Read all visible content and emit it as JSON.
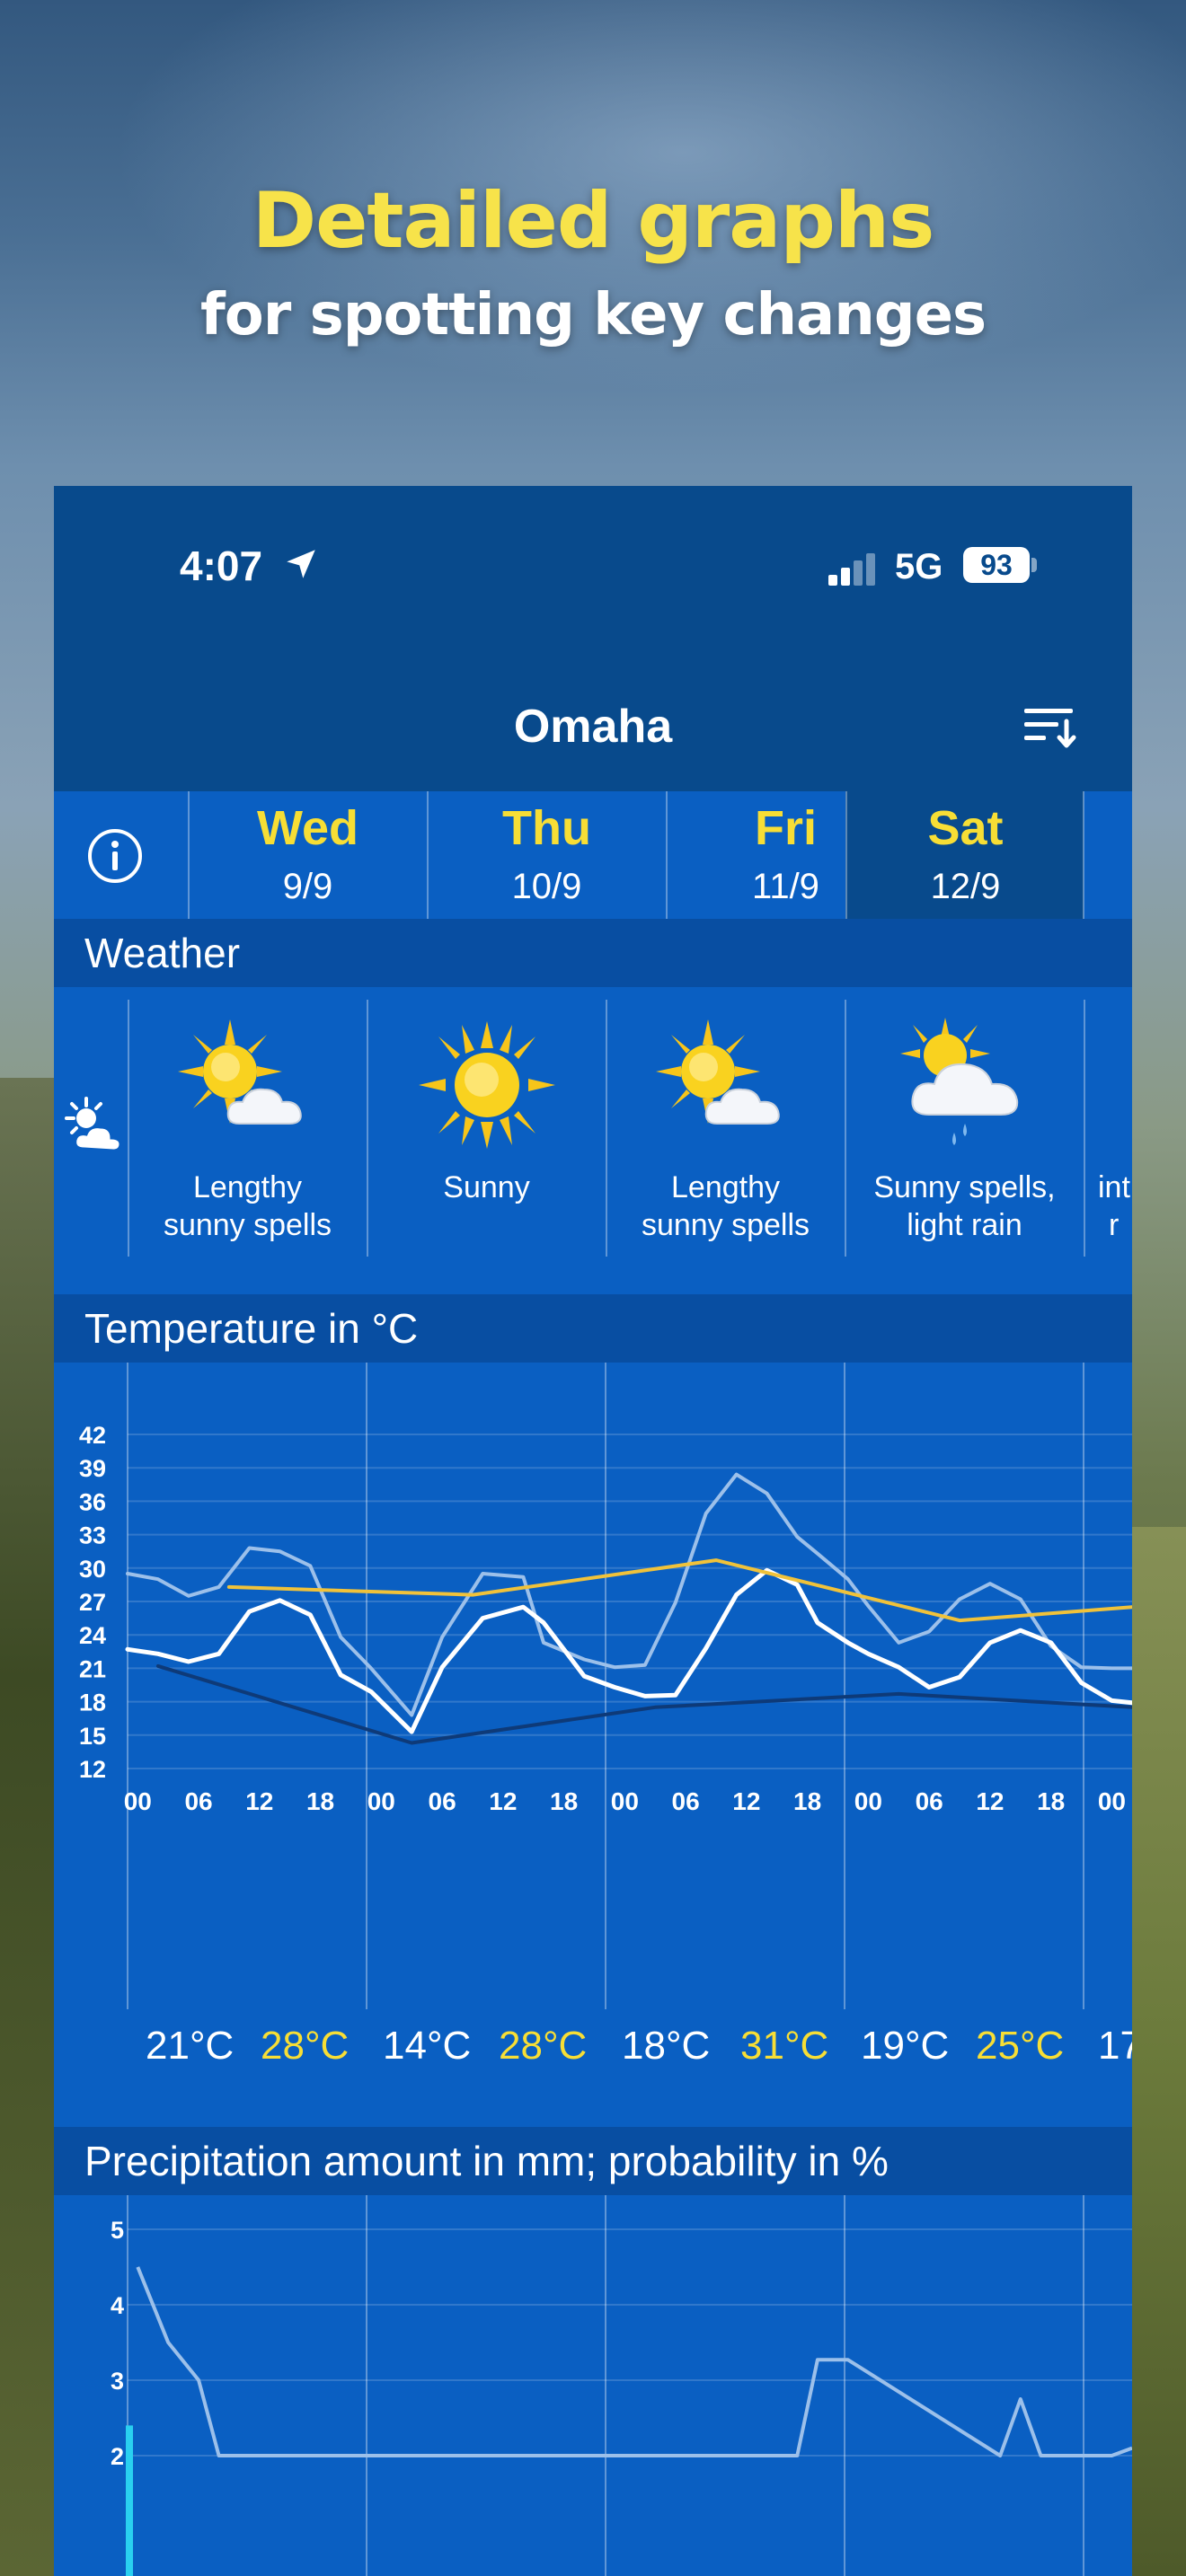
{
  "promo": {
    "headline": "Detailed graphs",
    "subheadline": "for spotting key changes"
  },
  "status_bar": {
    "time": "4:07",
    "network": "5G",
    "battery": "93"
  },
  "header": {
    "city": "Omaha",
    "icons": {
      "sort": "sort-icon",
      "location": "location-arrow-icon",
      "info": "info-icon"
    }
  },
  "days": [
    {
      "name": "Wed",
      "date": "9/9",
      "selected": false
    },
    {
      "name": "Thu",
      "date": "10/9",
      "selected": false
    },
    {
      "name": "Fri",
      "date": "11/9",
      "selected": false
    },
    {
      "name": "Sat",
      "date": "12/9",
      "selected": true
    }
  ],
  "weather_section": {
    "title": "Weather",
    "items": [
      {
        "icon": "sun-cloud-icon",
        "line1": "Lengthy",
        "line2": "sunny spells"
      },
      {
        "icon": "sun-icon",
        "line1": "Sunny",
        "line2": ""
      },
      {
        "icon": "sun-cloud-icon",
        "line1": "Lengthy",
        "line2": "sunny spells"
      },
      {
        "icon": "sun-rain-cloud-icon",
        "line1": "Sunny spells,",
        "line2": "light rain"
      },
      {
        "icon": "sun-rain-cloud-icon",
        "line1": "int",
        "line2": "r"
      }
    ]
  },
  "temperature_section": {
    "title": "Temperature in °C",
    "min_max": [
      {
        "min": "21°C",
        "max": "28°C"
      },
      {
        "min": "14°C",
        "max": "28°C"
      },
      {
        "min": "18°C",
        "max": "31°C"
      },
      {
        "min": "19°C",
        "max": "25°C"
      },
      {
        "min": "17",
        "max": ""
      }
    ]
  },
  "precipitation_section": {
    "title": "Precipitation amount in mm; probability in %"
  },
  "colors": {
    "app_blue": "#0a5fc2",
    "header_navy": "#084a8c",
    "section_header": "#084ea2",
    "day_yellow": "#f7de35",
    "max_trend": "#f0c23a",
    "min_trend": "#0e3a78",
    "feels_like": "#9cc0ea",
    "precip_bar": "#29d0f0"
  },
  "chart_data": [
    {
      "type": "line",
      "title": "Temperature in °C",
      "y_ticks": [
        42,
        39,
        36,
        33,
        30,
        27,
        24,
        21,
        18,
        15,
        12
      ],
      "ylim": [
        12,
        42
      ],
      "x_ticks": [
        "00",
        "06",
        "12",
        "18",
        "00",
        "06",
        "12",
        "18",
        "00",
        "06",
        "12",
        "18",
        "00",
        "06",
        "12",
        "18",
        "00"
      ],
      "x_unit": "hours from Wed 00:00",
      "xlim": [
        -1,
        98
      ],
      "grid": true,
      "series": [
        {
          "style": "feels-like (light blue)",
          "x": [
            -1,
            2,
            5,
            8,
            11,
            14,
            17,
            20,
            23,
            27,
            30,
            34,
            38,
            40,
            44,
            47,
            50,
            53,
            56,
            59,
            62,
            65,
            67,
            70,
            72,
            75,
            78,
            81,
            84,
            87,
            90,
            93,
            96,
            98
          ],
          "values": [
            29.5,
            29,
            27.5,
            28.3,
            31.8,
            31.5,
            30.2,
            23.8,
            21,
            16.8,
            23.8,
            29.5,
            29.2,
            23.3,
            21.8,
            21.1,
            21.3,
            26.9,
            34.9,
            38.4,
            36.7,
            32.8,
            31.3,
            29,
            26.6,
            23.3,
            24.3,
            27.2,
            28.6,
            27.2,
            23,
            21.1,
            21,
            21
          ],
          "color": "#9cc0ea"
        },
        {
          "style": "hourly temperature (white)",
          "x": [
            -1,
            2,
            5,
            8,
            11,
            14,
            17,
            20,
            23,
            27,
            30,
            34,
            38,
            40,
            44,
            47,
            50,
            53,
            56,
            59,
            62,
            65,
            67,
            70,
            72,
            75,
            78,
            81,
            84,
            87,
            90,
            93,
            96,
            98
          ],
          "values": [
            22.7,
            22.3,
            21.6,
            22.3,
            26.1,
            27.1,
            25.8,
            20.4,
            18.9,
            15.3,
            21.1,
            25.5,
            26.5,
            25.1,
            20.3,
            19.3,
            18.5,
            18.6,
            22.8,
            27.6,
            29.8,
            28.5,
            25.1,
            23.3,
            22.3,
            21.1,
            19.3,
            20.2,
            23.3,
            24.4,
            23.3,
            19.7,
            18.1,
            17.9
          ],
          "color": "#ffffff"
        },
        {
          "style": "daily max trend (yellow)",
          "x": [
            9,
            33,
            57,
            81,
            98
          ],
          "values": [
            28.3,
            27.6,
            30.7,
            25.3,
            26.5
          ],
          "color": "#f0c23a"
        },
        {
          "style": "daily min trend (navy)",
          "x": [
            2,
            27,
            51,
            75,
            98
          ],
          "values": [
            21.2,
            14.3,
            17.5,
            18.7,
            17.5
          ],
          "color": "#0e3a78"
        }
      ]
    },
    {
      "type": "line",
      "title": "Precipitation amount in mm; probability in %",
      "y_ticks": [
        5,
        4,
        3,
        2
      ],
      "ylim": [
        2,
        5
      ],
      "grid": true,
      "series": [
        {
          "style": "probability (light blue)",
          "x": [
            0,
            3,
            6,
            8,
            65,
            67,
            70,
            85,
            87,
            89,
            96,
            98
          ],
          "values": [
            4.5,
            3.5,
            3.0,
            2.0,
            2.0,
            3.27,
            3.27,
            2.0,
            2.75,
            2.0,
            2.0,
            2.1
          ],
          "color": "#9cc0ea"
        },
        {
          "style": "amount bar (cyan)",
          "x": [
            -0.5
          ],
          "values": [
            2.4
          ],
          "color": "#29d0f0"
        }
      ]
    }
  ]
}
